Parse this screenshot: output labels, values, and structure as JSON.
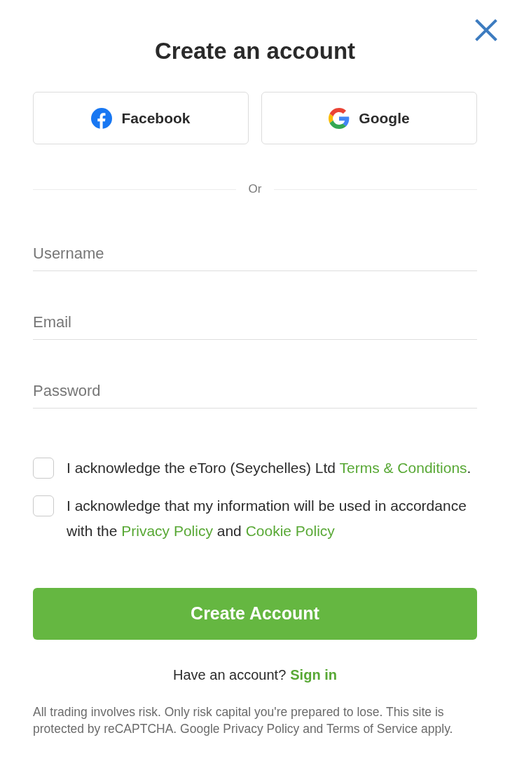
{
  "title": "Create an account",
  "social_buttons": [
    {
      "kind": "facebook",
      "label": "Facebook"
    },
    {
      "kind": "google",
      "label": "Google"
    }
  ],
  "divider": {
    "label": "Or"
  },
  "fields": [
    {
      "placeholder": "Username"
    },
    {
      "placeholder": "Email"
    },
    {
      "placeholder": "Password"
    }
  ],
  "consents": [
    {
      "checked": false,
      "parts": [
        {
          "text": "I acknowledge the eToro (Seychelles) Ltd ",
          "link": false
        },
        {
          "text": "Terms & Conditions",
          "link": true
        },
        {
          "text": ".",
          "link": false
        }
      ]
    },
    {
      "checked": false,
      "parts": [
        {
          "text": "I acknowledge that my information will be used in accordance with the ",
          "link": false
        },
        {
          "text": "Privacy Policy",
          "link": true
        },
        {
          "text": " and ",
          "link": false
        },
        {
          "text": "Cookie Policy",
          "link": true
        }
      ]
    }
  ],
  "submit": {
    "label": "Create Account"
  },
  "signin": {
    "prompt": "Have an account?",
    "link": "Sign in"
  },
  "disclaimer": "All trading involves risk. Only risk capital you're prepared to lose. This site is protected by reCAPTCHA. Google Privacy Policy and Terms of Service apply."
}
